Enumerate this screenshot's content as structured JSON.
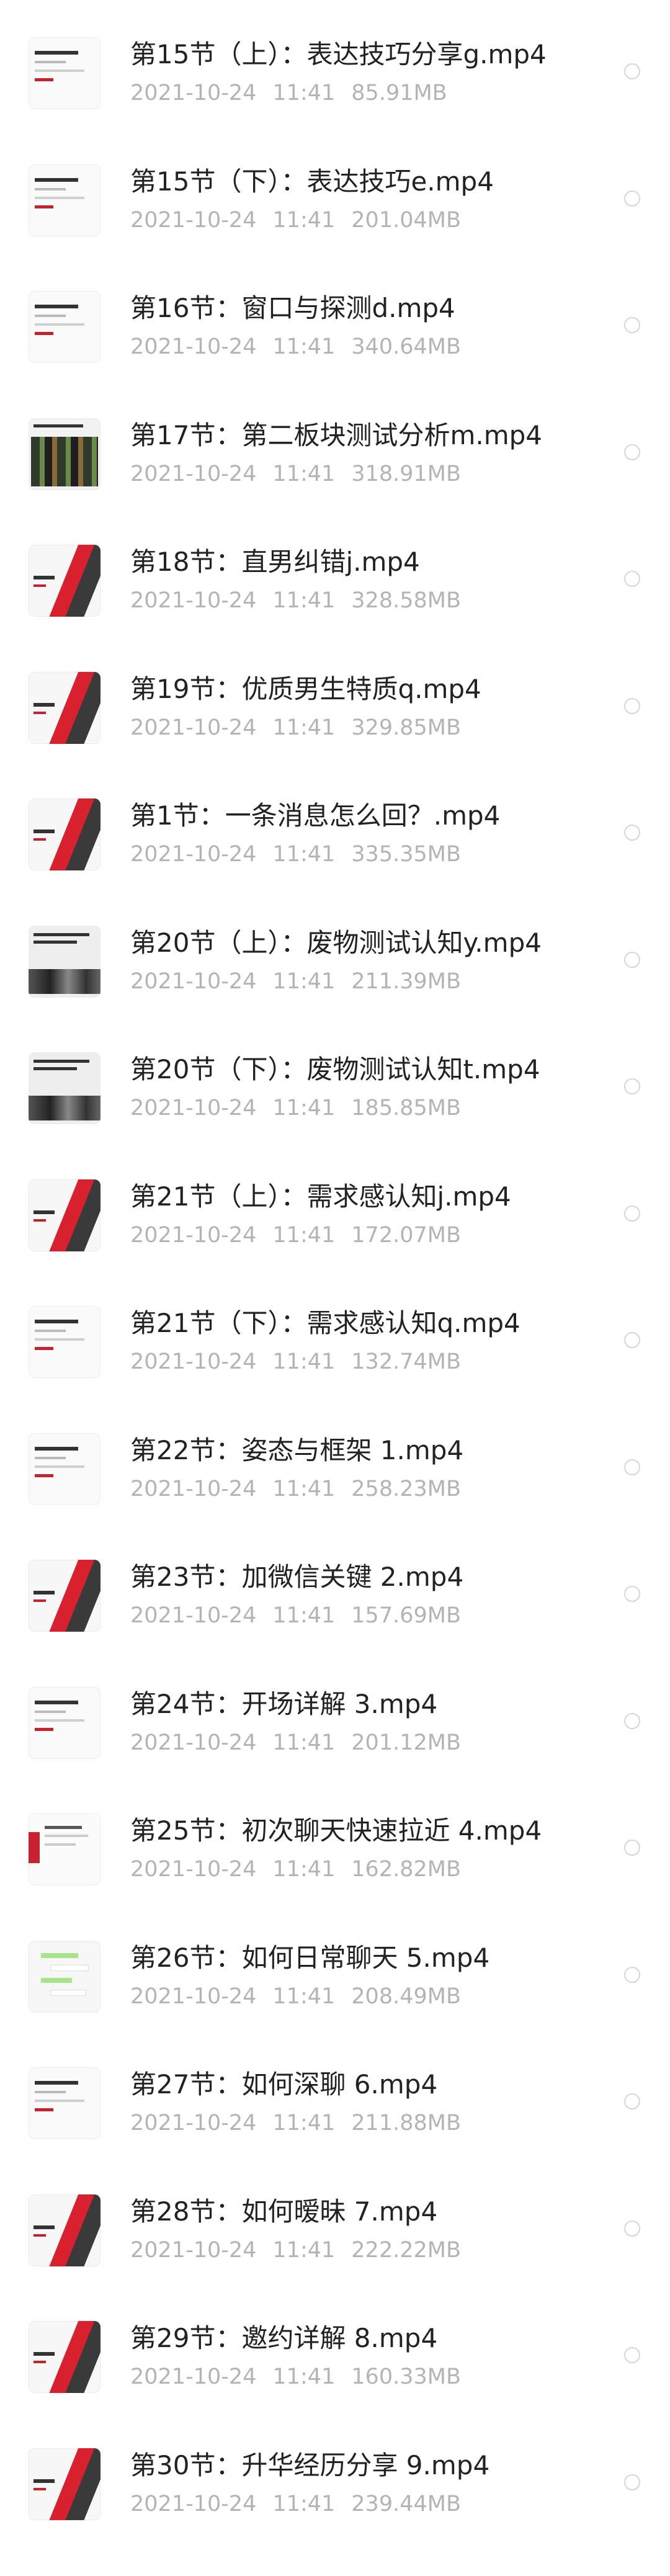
{
  "files": [
    {
      "title": "第15节（上）：表达技巧分享g.mp4",
      "date": "2021-10-24",
      "time": "11:41",
      "size": "85.91MB",
      "thumb": "t-white"
    },
    {
      "title": "第15节（下）：表达技巧e.mp4",
      "date": "2021-10-24",
      "time": "11:41",
      "size": "201.04MB",
      "thumb": "t-white"
    },
    {
      "title": "第16节：窗口与探测d.mp4",
      "date": "2021-10-24",
      "time": "11:41",
      "size": "340.64MB",
      "thumb": "t-white"
    },
    {
      "title": "第17节：第二板块测试分析m.mp4",
      "date": "2021-10-24",
      "time": "11:41",
      "size": "318.91MB",
      "thumb": "t-green"
    },
    {
      "title": "第18节：直男纠错j.mp4",
      "date": "2021-10-24",
      "time": "11:41",
      "size": "328.58MB",
      "thumb": "t-red"
    },
    {
      "title": "第19节：优质男生特质q.mp4",
      "date": "2021-10-24",
      "time": "11:41",
      "size": "329.85MB",
      "thumb": "t-red"
    },
    {
      "title": "第1节：一条消息怎么回？.mp4",
      "date": "2021-10-24",
      "time": "11:41",
      "size": "335.35MB",
      "thumb": "t-red"
    },
    {
      "title": "第20节（上）：废物测试认知y.mp4",
      "date": "2021-10-24",
      "time": "11:41",
      "size": "211.39MB",
      "thumb": "t-dark"
    },
    {
      "title": "第20节（下）：废物测试认知t.mp4",
      "date": "2021-10-24",
      "time": "11:41",
      "size": "185.85MB",
      "thumb": "t-dark"
    },
    {
      "title": "第21节（上）：需求感认知j.mp4",
      "date": "2021-10-24",
      "time": "11:41",
      "size": "172.07MB",
      "thumb": "t-red"
    },
    {
      "title": "第21节（下）：需求感认知q.mp4",
      "date": "2021-10-24",
      "time": "11:41",
      "size": "132.74MB",
      "thumb": "t-white"
    },
    {
      "title": "第22节：姿态与框架 1.mp4",
      "date": "2021-10-24",
      "time": "11:41",
      "size": "258.23MB",
      "thumb": "t-white"
    },
    {
      "title": "第23节：加微信关键 2.mp4",
      "date": "2021-10-24",
      "time": "11:41",
      "size": "157.69MB",
      "thumb": "t-red"
    },
    {
      "title": "第24节：开场详解 3.mp4",
      "date": "2021-10-24",
      "time": "11:41",
      "size": "201.12MB",
      "thumb": "t-white"
    },
    {
      "title": "第25节：初次聊天快速拉近 4.mp4",
      "date": "2021-10-24",
      "time": "11:41",
      "size": "162.82MB",
      "thumb": "t-side"
    },
    {
      "title": "第26节：如何日常聊天 5.mp4",
      "date": "2021-10-24",
      "time": "11:41",
      "size": "208.49MB",
      "thumb": "t-chat"
    },
    {
      "title": "第27节：如何深聊 6.mp4",
      "date": "2021-10-24",
      "time": "11:41",
      "size": "211.88MB",
      "thumb": "t-white"
    },
    {
      "title": "第28节：如何暧昧 7.mp4",
      "date": "2021-10-24",
      "time": "11:41",
      "size": "222.22MB",
      "thumb": "t-red"
    },
    {
      "title": "第29节：邀约详解 8.mp4",
      "date": "2021-10-24",
      "time": "11:41",
      "size": "160.33MB",
      "thumb": "t-red"
    },
    {
      "title": "第30节：升华经历分享 9.mp4",
      "date": "2021-10-24",
      "time": "11:41",
      "size": "239.44MB",
      "thumb": "t-red"
    }
  ]
}
